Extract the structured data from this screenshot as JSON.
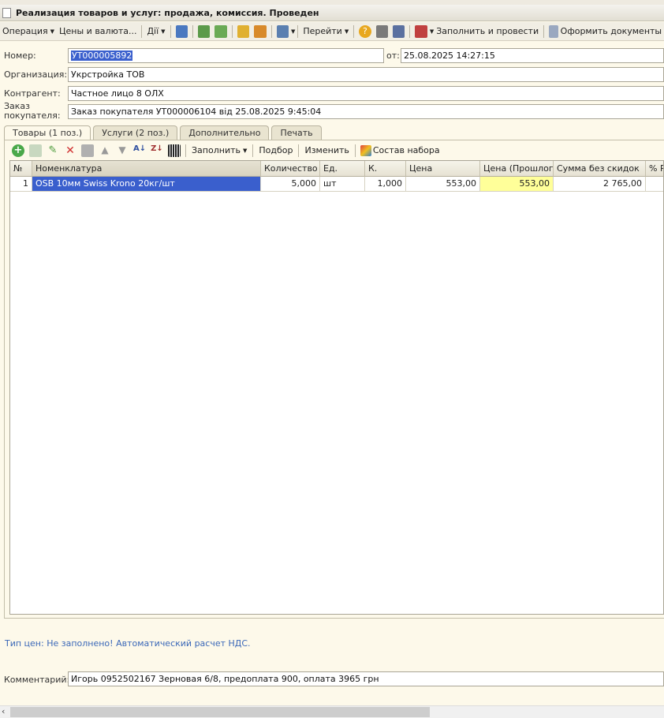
{
  "window": {
    "title": "Реализация товаров и услуг: продажа, комиссия. Проведен"
  },
  "toolbar": {
    "operation": "Операция",
    "prices": "Цены и валюта...",
    "actions": "Дії",
    "goto": "Перейти",
    "fill_post": "Заполнить и провести",
    "make_docs": "Оформить документы"
  },
  "form": {
    "number_label": "Номер:",
    "number_value": "УТ000005892",
    "date_label": "от:",
    "date_value": "25.08.2025 14:27:15",
    "org_label": "Организация:",
    "org_value": "Укрстройка ТОВ",
    "contractor_label": "Контрагент:",
    "contractor_value": "Частное лицо 8 ОЛХ",
    "order_label_1": "Заказ",
    "order_label_2": "покупателя:",
    "order_value": "Заказ покупателя УТ000006104 від 25.08.2025 9:45:04"
  },
  "tabs": [
    "Товары (1 поз.)",
    "Услуги (2 поз.)",
    "Дополнительно",
    "Печать"
  ],
  "table_toolbar": {
    "fill": "Заполнить",
    "pick": "Подбор",
    "change": "Изменить",
    "kit": "Состав набора"
  },
  "table": {
    "headers": [
      "№",
      "Номенклатура",
      "Количество",
      "Ед.",
      "К.",
      "Цена",
      "Цена (Прошлог...",
      "Сумма без скидок",
      "% Ру"
    ],
    "rows": [
      [
        "1",
        "OSB  10мм Swiss Krono 20кг/шт",
        "5,000",
        "шт",
        "1,000",
        "553,00",
        "553,00",
        "2 765,00",
        ""
      ]
    ]
  },
  "note": "Тип цен: Не заполнено! Автоматический расчет НДС.",
  "comment": {
    "label": "Комментарий:",
    "value": "Игорь 0952502167 Зерновая 6/8, предоплата 900, оплата 3965 грн"
  },
  "colors": {
    "selection": "#3a5fcd",
    "highlight_cell": "#ffff99",
    "note_text": "#3b68b8"
  }
}
